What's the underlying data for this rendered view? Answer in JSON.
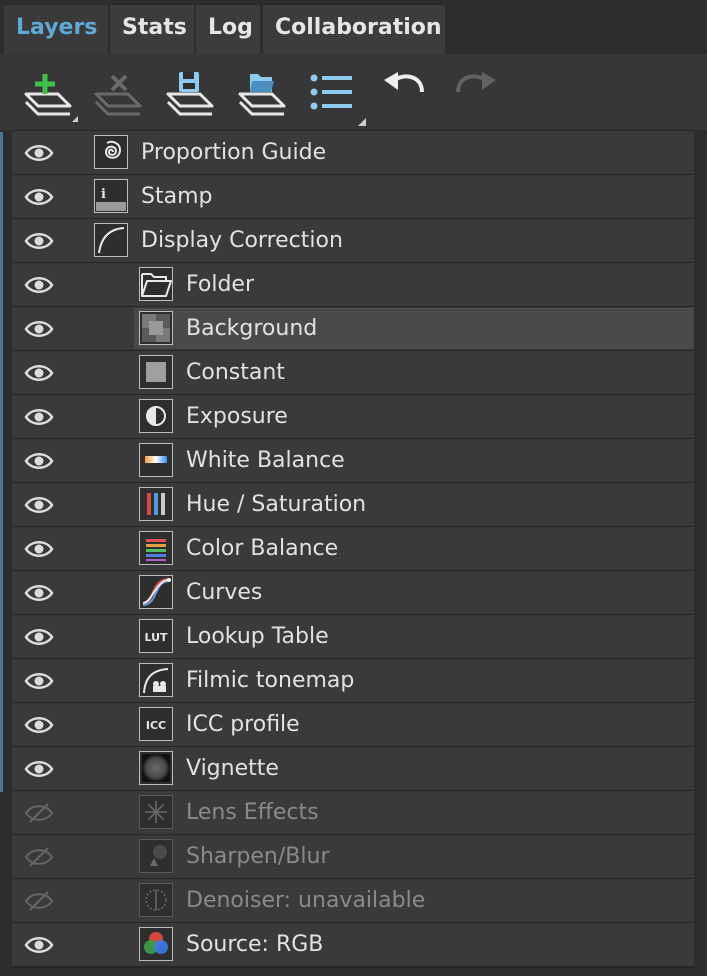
{
  "tabs": [
    {
      "label": "Layers",
      "active": true
    },
    {
      "label": "Stats",
      "active": false
    },
    {
      "label": "Log",
      "active": false
    },
    {
      "label": "Collaboration",
      "active": false
    }
  ],
  "toolbar": {
    "buttons": [
      {
        "name": "add-layer",
        "icon": "add-layer-icon",
        "enabled": true
      },
      {
        "name": "delete-layer",
        "icon": "delete-layer-icon",
        "enabled": false
      },
      {
        "name": "save-layer",
        "icon": "save-layer-icon",
        "enabled": true
      },
      {
        "name": "open-layer",
        "icon": "open-layer-icon",
        "enabled": true
      },
      {
        "name": "list-menu",
        "icon": "list-icon",
        "enabled": true
      },
      {
        "name": "undo",
        "icon": "undo-icon",
        "enabled": true
      },
      {
        "name": "redo",
        "icon": "redo-icon",
        "enabled": false
      }
    ]
  },
  "layers": [
    {
      "label": "Proportion Guide",
      "icon": "spiral-icon",
      "visible": true,
      "enabled": true,
      "level": 0
    },
    {
      "label": "Stamp",
      "icon": "info-stamp-icon",
      "visible": true,
      "enabled": true,
      "level": 0
    },
    {
      "label": "Display Correction",
      "icon": "curve-icon",
      "visible": true,
      "enabled": true,
      "level": 0
    },
    {
      "label": "Folder",
      "icon": "folder-icon",
      "visible": true,
      "enabled": true,
      "level": 1
    },
    {
      "label": "Background",
      "icon": "background-icon",
      "visible": true,
      "enabled": true,
      "level": 1,
      "selected": true
    },
    {
      "label": "Constant",
      "icon": "constant-icon",
      "visible": true,
      "enabled": true,
      "level": 1
    },
    {
      "label": "Exposure",
      "icon": "exposure-icon",
      "visible": true,
      "enabled": true,
      "level": 1
    },
    {
      "label": "White Balance",
      "icon": "white-balance-icon",
      "visible": true,
      "enabled": true,
      "level": 1
    },
    {
      "label": "Hue / Saturation",
      "icon": "hue-saturation-icon",
      "visible": true,
      "enabled": true,
      "level": 1
    },
    {
      "label": "Color Balance",
      "icon": "color-balance-icon",
      "visible": true,
      "enabled": true,
      "level": 1
    },
    {
      "label": "Curves",
      "icon": "curves-icon",
      "visible": true,
      "enabled": true,
      "level": 1
    },
    {
      "label": "Lookup Table",
      "icon": "lut-icon",
      "icon_text": "LUT",
      "visible": true,
      "enabled": true,
      "level": 1
    },
    {
      "label": "Filmic tonemap",
      "icon": "filmic-icon",
      "visible": true,
      "enabled": true,
      "level": 1
    },
    {
      "label": "ICC profile",
      "icon": "icc-icon",
      "icon_text": "ICC",
      "visible": true,
      "enabled": true,
      "level": 1
    },
    {
      "label": "Vignette",
      "icon": "vignette-icon",
      "visible": true,
      "enabled": true,
      "level": 1
    },
    {
      "label": "Lens Effects",
      "icon": "lens-effects-icon",
      "visible": false,
      "enabled": false,
      "level": 1
    },
    {
      "label": "Sharpen/Blur",
      "icon": "sharpen-blur-icon",
      "visible": false,
      "enabled": false,
      "level": 1
    },
    {
      "label": "Denoiser: unavailable",
      "icon": "denoiser-icon",
      "visible": false,
      "enabled": false,
      "level": 1
    },
    {
      "label": "Source: RGB",
      "icon": "source-rgb-icon",
      "visible": true,
      "enabled": true,
      "level": 1
    }
  ],
  "colors": {
    "accent": "#5fa9d6",
    "add_icon": "#3ec24a",
    "save_icon": "#8ecbf0"
  }
}
